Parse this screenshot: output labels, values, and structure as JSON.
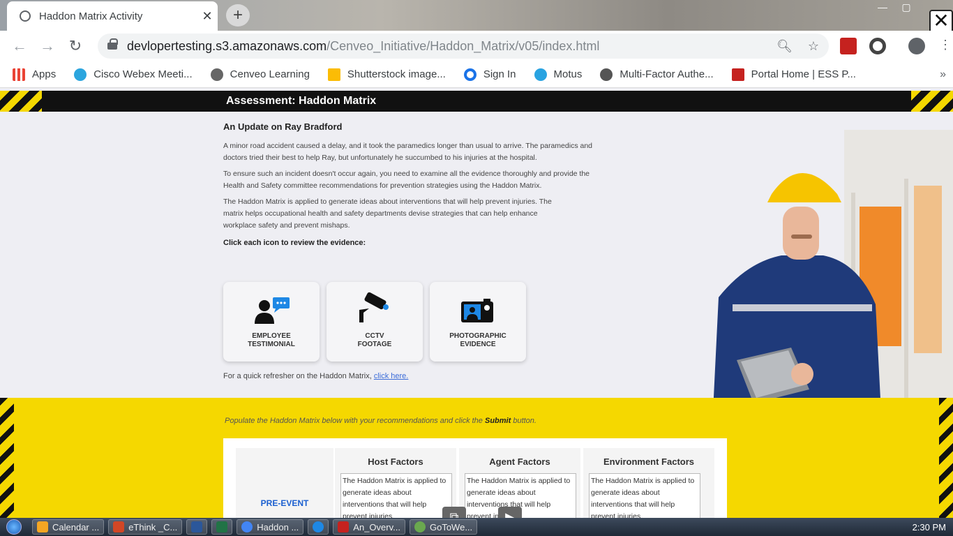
{
  "browser": {
    "tab_title": "Haddon Matrix Activity",
    "tab_close": "✕",
    "new_tab": "+",
    "url_host": "devlopertesting.s3.amazonaws.com",
    "url_path": "/Cenveo_Initiative/Haddon_Matrix/v05/index.html",
    "bookmarks": [
      {
        "label": "Apps",
        "color": "#ea4335"
      },
      {
        "label": "Cisco Webex Meeti...",
        "color": "#2ba5de"
      },
      {
        "label": "Cenveo Learning",
        "color": "#666666"
      },
      {
        "label": "Shutterstock image...",
        "color": "#fbbc05"
      },
      {
        "label": "Sign In",
        "color": "#1a73e8"
      },
      {
        "label": "Motus",
        "color": "#29a3e1"
      },
      {
        "label": "Multi-Factor Authe...",
        "color": "#555555"
      },
      {
        "label": "Portal Home | ESS P...",
        "color": "#c5221f"
      }
    ],
    "bookmarks_more": "»"
  },
  "page": {
    "assessment_title": "Assessment: Haddon Matrix",
    "update_heading": "An Update on Ray Bradford",
    "paragraphs": [
      "A minor road accident caused a delay, and it took the paramedics longer than usual to arrive. The paramedics and doctors tried their best to help Ray, but unfortunately he succumbed to his injuries at the hospital.",
      "To ensure such an incident doesn't occur again, you need to examine all the evidence thoroughly and provide the Health and Safety committee recommendations for prevention strategies using the Haddon Matrix.",
      "The Haddon Matrix is applied to generate ideas about interventions that will help prevent injuries. The matrix helps occupational health and safety departments devise strategies that can help enhance workplace safety and prevent mishaps."
    ],
    "click_heading": "Click each icon to review the evidence:",
    "cards": [
      {
        "line1": "EMPLOYEE",
        "line2": "TESTIMONIAL"
      },
      {
        "line1": "CCTV",
        "line2": "FOOTAGE"
      },
      {
        "line1": "PHOTOGRAPHIC",
        "line2": "EVIDENCE"
      }
    ],
    "refresher_text": "For a quick refresher on the Haddon Matrix,",
    "refresher_link": "click here.",
    "instruction_prefix": "Populate the Haddon Matrix below with your recommendations and click the",
    "instruction_bold": "Submit",
    "instruction_suffix": "button.",
    "matrix": {
      "row_label": "PRE-EVENT",
      "columns": [
        "Host Factors",
        "Agent Factors",
        "Environment Factors"
      ],
      "cell_text": "The Haddon Matrix is applied to generate ideas about interventions that will help prevent injuries."
    }
  },
  "taskbar": {
    "items": [
      {
        "label": "Calendar ...",
        "color": "#f5a623"
      },
      {
        "label": "eThink _C...",
        "color": "#d24726"
      },
      {
        "label": "",
        "color": "#2b579a"
      },
      {
        "label": "",
        "color": "#217346"
      },
      {
        "label": "Haddon ...",
        "color": "#4285f4"
      },
      {
        "label": "",
        "color": "#1e88e5"
      },
      {
        "label": "An_Overv...",
        "color": "#c5221f"
      },
      {
        "label": "GoToWe...",
        "color": "#6aa84f"
      }
    ],
    "clock": "2:30 PM"
  },
  "colors": {
    "hazard_yellow": "#f5d800",
    "link": "#3a6bd8",
    "pre_event": "#1a5fd0"
  }
}
